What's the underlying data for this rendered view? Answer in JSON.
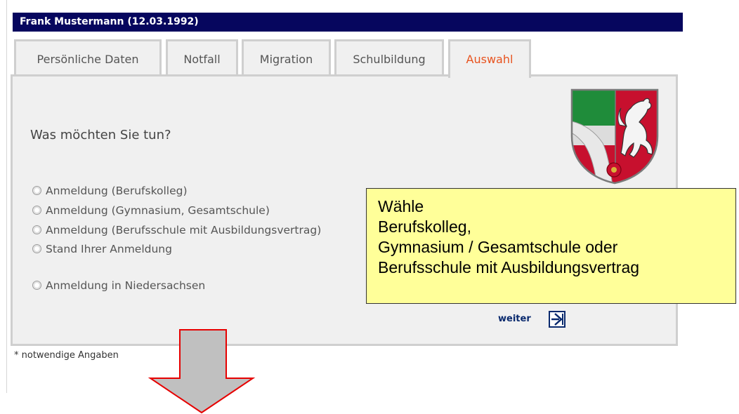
{
  "header": {
    "title": "Frank Mustermann (12.03.1992)"
  },
  "tabs": [
    {
      "label": "Persönliche Daten"
    },
    {
      "label": "Notfall"
    },
    {
      "label": "Migration"
    },
    {
      "label": "Schulbildung"
    },
    {
      "label": "Auswahl",
      "active": true
    }
  ],
  "main": {
    "question": "Was möchten Sie tun?",
    "options": [
      {
        "label": "Anmeldung (Berufskolleg)"
      },
      {
        "label": "Anmeldung (Gymnasium, Gesamtschule)"
      },
      {
        "label": "Anmeldung (Berufsschule mit Ausbildungsvertrag)"
      },
      {
        "label": "Stand Ihrer Anmeldung"
      },
      {
        "label": "Anmeldung in Niedersachsen"
      }
    ],
    "weiter_label": "weiter",
    "weiter_icon": "arrow-right-icon",
    "crest_icon": "nrw-coat-of-arms-icon"
  },
  "callout": {
    "lines": [
      "Wähle",
      "Berufskolleg,",
      "Gymnasium / Gesamtschule oder",
      "Berufsschule mit Ausbildungsvertrag"
    ]
  },
  "footer": {
    "note": "* notwendige Angaben"
  },
  "colors": {
    "title_bar": "#06065e",
    "active_tab_text": "#e8531f",
    "callout_bg": "#ffff99",
    "arrow_fill": "#c0c0c0",
    "arrow_stroke": "#e60000",
    "link": "#0a2a6e"
  }
}
